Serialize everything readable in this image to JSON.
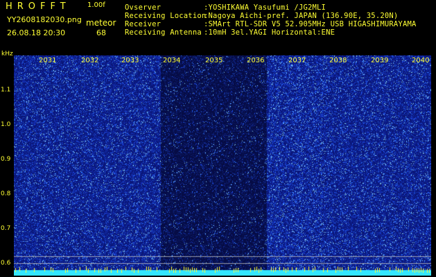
{
  "header": {
    "app_name": "HROFFT",
    "version": "1.00f",
    "filename": "YY2608182030.png",
    "datetime": "26.08.18 20:30",
    "meteor_label": "meteor",
    "meteor_count": "68"
  },
  "info": [
    {
      "key": "Ovserver",
      "value": ":YOSHIKAWA Yasufumi /JG2MLI"
    },
    {
      "key": "Receiving Location",
      "value": ":Nagoya Aichi-pref. JAPAN (136.90E, 35.20N)"
    },
    {
      "key": "Receiver",
      "value": ":SMArt RTL-SDR V5 52.905MHz USB HIGASHIMURAYAMA"
    },
    {
      "key": "Receiving Antenna",
      "value": ":10mH 3el.YAGI Horizontal:ENE"
    }
  ],
  "axis": {
    "y_unit": "kHz",
    "y_ticks": [
      "1.1",
      "1.0",
      "0.9",
      "0.8",
      "0.7",
      "0.6"
    ],
    "x_ticks": [
      "2031",
      "2032",
      "2033",
      "2034",
      "2035",
      "2036",
      "2037",
      "2038",
      "2039",
      "2040"
    ]
  },
  "colors": {
    "text": "#ffff33",
    "background": "#000000",
    "noise_base": "#0a1a7a",
    "noise_dim_base": "#050a45",
    "baseline": "#33e6ff"
  }
}
